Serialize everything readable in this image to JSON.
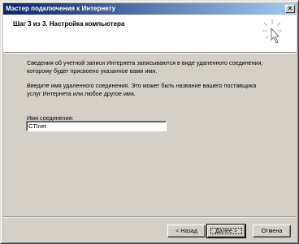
{
  "window": {
    "title": "Мастер подключения к Интернету",
    "close_glyph": "✕"
  },
  "header": {
    "step_title": "Шаг 3 из 3. Настройка компьютера",
    "icon": "wizard-wand-icon"
  },
  "body": {
    "paragraph1": "Сведения об учетной записи Интернета записываются в виде удаленного соединения, которому будет присвоено указанное вами имя.",
    "paragraph2": "Введите имя удаленного соединения. Это может быть название вашего поставщика услуг Интернета или любое другое имя.",
    "connection_name_label": "Имя соединения:",
    "connection_name_value": "CTInet"
  },
  "buttons": {
    "back": "< Назад",
    "next": "Далее >",
    "cancel": "Отмена"
  }
}
